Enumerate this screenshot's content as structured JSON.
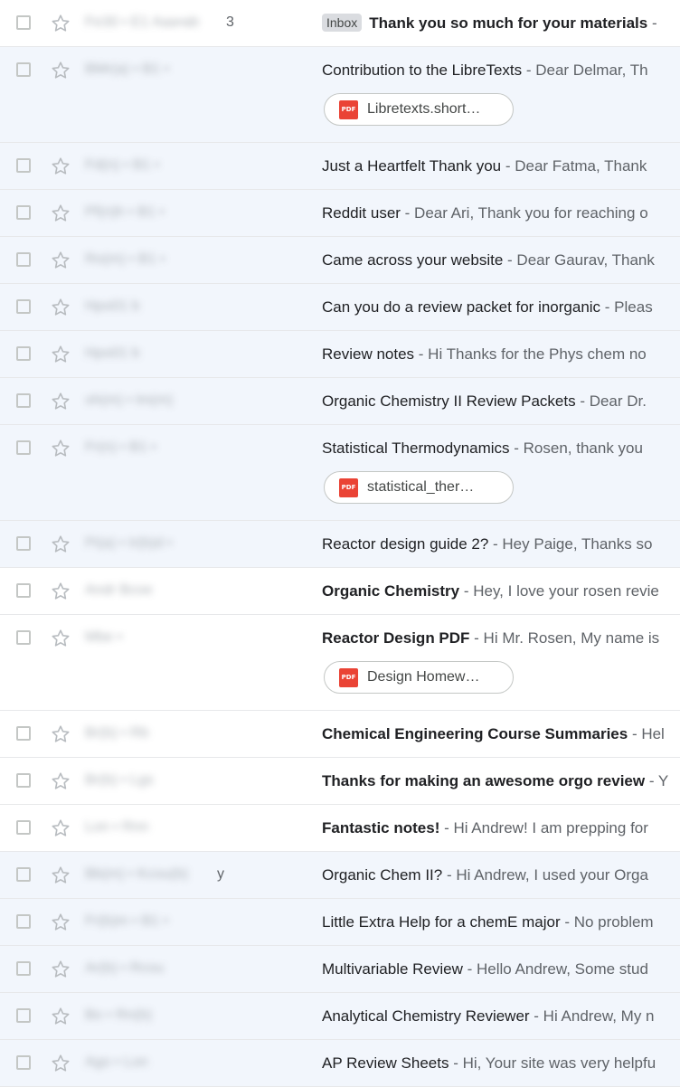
{
  "colors": {
    "unread_bg": "#ffffff",
    "read_bg": "#f2f6fc",
    "label_bg": "#dadce0",
    "pdf_red": "#ea4335"
  },
  "emails": [
    {
      "sender": "Fe30 • E1 Aaa•ab",
      "sender_tail": "3",
      "label": "Inbox",
      "subject": "Thank you so much for your materials",
      "snippet": " -",
      "unread": true,
      "attachment": null
    },
    {
      "sender": "BMr(a) • B1 •",
      "subject": "Contribution to the LibreTexts",
      "snippet": " - Dear Delmar, Th",
      "unread": false,
      "attachment": "Libretexts.short…"
    },
    {
      "sender": "Fd(n) • B1 •",
      "subject": "Just a Heartfelt Thank you",
      "snippet": " - Dear Fatma, Thank",
      "unread": false,
      "attachment": null
    },
    {
      "sender": "Pf(n)h • B1 •",
      "subject": "Reddit user",
      "snippet": " - Dear Ari, Thank you for reaching o",
      "unread": false,
      "attachment": null
    },
    {
      "sender": "Ro(m) • B1 •",
      "subject": "Came across your website",
      "snippet": " - Dear Gaurav, Thank",
      "unread": false,
      "attachment": null
    },
    {
      "sender": "Hpo01 b",
      "subject": "Can you do a review packet for inorganic",
      "snippet": " - Pleas",
      "unread": false,
      "attachment": null
    },
    {
      "sender": "Hpo01 b",
      "subject": "Review notes",
      "snippet": " - Hi Thanks for the Phys chem no",
      "unread": false,
      "attachment": null
    },
    {
      "sender": "oh(m) • lm(m)",
      "subject": "Organic Chemistry II Review Packets",
      "snippet": " - Dear Dr.",
      "unread": false,
      "attachment": null
    },
    {
      "sender": "Fr(n) • B1 •",
      "subject": "Statistical Thermodynamics",
      "snippet": " - Rosen, thank you",
      "unread": false,
      "attachment": "statistical_ther…"
    },
    {
      "sender": "Pi(a) • Ir(b)d •",
      "subject": "Reactor design guide 2?",
      "snippet": " - Hey Paige, Thanks so",
      "unread": false,
      "attachment": null
    },
    {
      "sender": "Andr Bcoe",
      "subject": "Organic Chemistry",
      "snippet": " - Hey, I love your rosen revie",
      "unread": true,
      "attachment": null
    },
    {
      "sender": "Mbe •",
      "subject": "Reactor Design PDF",
      "snippet": " - Hi Mr. Rosen, My name is",
      "unread": true,
      "attachment": "Design Homew…"
    },
    {
      "sender": "Br(b) • Rb",
      "subject": "Chemical Engineering Course Summaries",
      "snippet": " - Hel",
      "unread": true,
      "attachment": null
    },
    {
      "sender": "Br(b) • Lgs",
      "subject": "Thanks for making an awesome orgo review",
      "snippet": " - Y",
      "unread": true,
      "attachment": null
    },
    {
      "sender": "Lon • Rnn",
      "subject": "Fantastic notes!",
      "snippet": " - Hi Andrew! I am prepping for",
      "unread": true,
      "attachment": null
    },
    {
      "sender": "Bb(m) • Kcou(b)",
      "sender_tail": "y",
      "subject": "Organic Chem II?",
      "snippet": " - Hi Andrew, I used your Orga",
      "unread": false,
      "attachment": null
    },
    {
      "sender": "Fr(b)m • B1 •",
      "subject": "Little Extra Help for a chemE major",
      "snippet": " - No problem",
      "unread": false,
      "attachment": null
    },
    {
      "sender": "Ar(b) • Rcou",
      "subject": "Multivariable Review",
      "snippet": " - Hello Andrew, Some stud",
      "unread": false,
      "attachment": null
    },
    {
      "sender": "Bo • Rn(b)",
      "subject": "Analytical Chemistry Reviewer",
      "snippet": " - Hi Andrew, My n",
      "unread": false,
      "attachment": null
    },
    {
      "sender": "Ago • Lon",
      "subject": "AP Review Sheets",
      "snippet": " - Hi, Your site was very helpfu",
      "unread": false,
      "attachment": null
    }
  ]
}
